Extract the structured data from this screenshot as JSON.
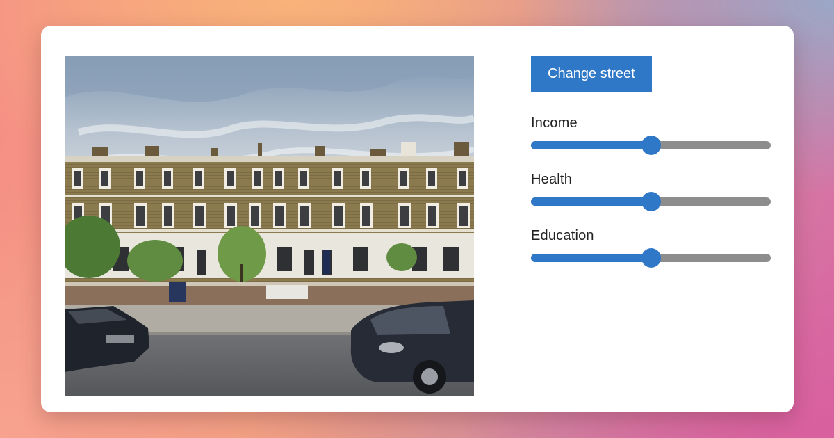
{
  "image": {
    "alt": "",
    "subject": "street-view-photo"
  },
  "controls": {
    "change_button_label": "Change street",
    "sliders": [
      {
        "label": "Income",
        "value": 0.5
      },
      {
        "label": "Health",
        "value": 0.5
      },
      {
        "label": "Education",
        "value": 0.5
      }
    ]
  },
  "colors": {
    "accent": "#2f78c8",
    "track": "#8d8d8d"
  }
}
